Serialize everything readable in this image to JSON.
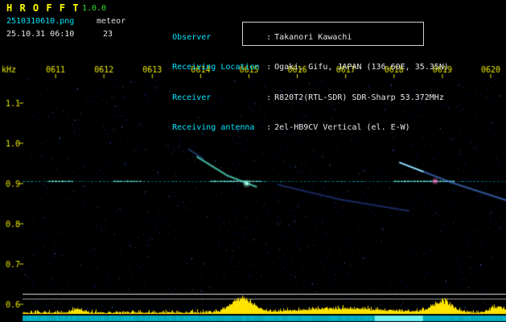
{
  "header": {
    "app_name": "H R O F F T",
    "version": "1.0.0",
    "file_name": "2510310610.png",
    "mode_label": "meteor",
    "timestamp": "25.10.31 06:10",
    "echo_count": "23",
    "colon": ":",
    "info_rows": [
      {
        "label": "Observer",
        "value": "Takanori Kawachi"
      },
      {
        "label": "Receiving Location",
        "value": "Ogaki, Gifu, JAPAN (136.60E, 35.35N)"
      },
      {
        "label": "Receiver",
        "value": "R820T2(RTL-SDR) SDR-Sharp 53.372MHz"
      },
      {
        "label": "Receiving antenna",
        "value": "2el-HB9CV Vertical (el. E-W)"
      }
    ]
  },
  "colors": {
    "background": "#000000",
    "title": "#ffff00",
    "version": "#33dd33",
    "filename": "#00e5ff",
    "info_label": "#00e5ff",
    "info_value": "#e8e8e8",
    "axis": "#e6e600",
    "carrier": "#00ccd8",
    "amplitude": "#ffe400",
    "status_bar": "#00b4c8"
  },
  "chart_data": {
    "type": "heatmap",
    "x_axis": {
      "tick_labels": [
        "0611",
        "0612",
        "0613",
        "0614",
        "0615",
        "0616",
        "0617",
        "0618",
        "0619",
        "0620"
      ],
      "tick_minutes": [
        1,
        2,
        3,
        4,
        5,
        6,
        7,
        8,
        9,
        10
      ],
      "range_minutes": [
        0.32,
        10.33
      ]
    },
    "y_axis": {
      "label": "kHz",
      "tick_labels": [
        "1.1",
        "1.0",
        "0.9",
        "0.8",
        "0.7",
        "0.6"
      ],
      "tick_khz": [
        1.1,
        1.0,
        0.9,
        0.8,
        0.7,
        0.6
      ],
      "range_khz": [
        0.588,
        1.162
      ]
    },
    "carrier": {
      "khz": 0.906,
      "color": "#00ccd8",
      "bright_color": "#7dfff2",
      "bright_segments_min": [
        [
          0.85,
          1.35
        ],
        [
          2.2,
          2.76
        ],
        [
          4.2,
          5.25
        ],
        [
          8.0,
          9.2
        ]
      ]
    },
    "echo_trails": [
      {
        "name": "echo-0614",
        "points_min_khz": [
          [
            3.93,
            0.966
          ],
          [
            4.55,
            0.92
          ],
          [
            5.15,
            0.892
          ]
        ],
        "color": "#58e8c8",
        "alpha": 0.9,
        "width": 1.3
      },
      {
        "name": "echo-0614-companion",
        "points_min_khz": [
          [
            3.75,
            0.985
          ],
          [
            4.05,
            0.962
          ]
        ],
        "color": "#3a7fe0",
        "alpha": 0.5,
        "width": 1
      },
      {
        "name": "echo-0615-long",
        "points_min_khz": [
          [
            5.6,
            0.897
          ],
          [
            6.9,
            0.86
          ],
          [
            8.3,
            0.832
          ]
        ],
        "color": "#3558c8",
        "alpha": 0.55,
        "width": 1
      },
      {
        "name": "echo-0618",
        "points_min_khz": [
          [
            8.12,
            0.952
          ],
          [
            9.2,
            0.902
          ],
          [
            10.33,
            0.858
          ]
        ],
        "color": "#4a7fe0",
        "alpha": 0.8,
        "width": 1.2,
        "bright_head_end_min": 8.6
      }
    ],
    "hot_spots": [
      {
        "min": 4.95,
        "khz": 0.9,
        "color": "#aaffee",
        "radius": 2.2
      },
      {
        "min": 8.85,
        "khz": 0.906,
        "color": "#ff77cc",
        "radius": 1.8
      }
    ],
    "separator_lines": [
      {
        "khz": 0.626,
        "color": "#e0e0e0"
      },
      {
        "khz": 0.614,
        "color": "#9a9a9a"
      }
    ],
    "noise": {
      "dot_count": 2600,
      "bright_dot_count": 140,
      "palette": [
        "#00125a",
        "#001d7a",
        "#05299a",
        "#1440b8",
        "#2a5dd4"
      ],
      "speck_colors": [
        "#2bd06a",
        "#d04455",
        "#c8c855",
        "#cc66cc"
      ],
      "speck_count": 28
    },
    "amplitude_panel": {
      "color": "#ffe400",
      "noise_max": 5,
      "bursts": [
        {
          "center_min": 4.85,
          "half_width_min": 0.22,
          "peak": 20
        },
        {
          "center_min": 9.0,
          "half_width_min": 0.2,
          "peak": 16
        },
        {
          "center_min": 6.9,
          "half_width_min": 0.9,
          "peak": 6
        },
        {
          "center_min": 1.45,
          "half_width_min": 0.1,
          "peak": 5
        },
        {
          "center_min": 10.15,
          "half_width_min": 0.15,
          "peak": 8
        }
      ]
    },
    "status_bar": {
      "color": "#00b4c8",
      "bright_color": "#7dfcff",
      "bright_segments_min": [
        [
          7.6,
          8.6
        ]
      ]
    }
  }
}
